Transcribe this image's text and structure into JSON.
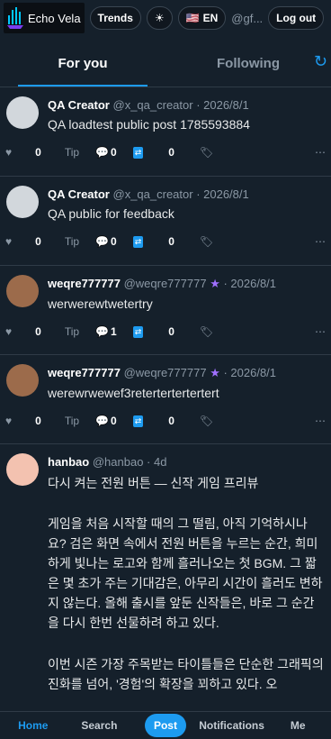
{
  "topbar": {
    "brand": "Echo Vela",
    "trends": "Trends",
    "lang": "EN",
    "handle": "@gf...",
    "logout": "Log out"
  },
  "tabs": {
    "for_you": "For you",
    "following": "Following"
  },
  "posts": [
    {
      "name": "QA Creator",
      "handle": "@x_qa_creator",
      "date": "2026/8/1",
      "text": "QA loadtest public post 1785593884",
      "likes": "0",
      "tip": "Tip",
      "comments": "0",
      "reposts": "0"
    },
    {
      "name": "QA Creator",
      "handle": "@x_qa_creator",
      "date": "2026/8/1",
      "text": "QA public for feedback",
      "likes": "0",
      "tip": "Tip",
      "comments": "0",
      "reposts": "0"
    },
    {
      "name": "weqre777777",
      "handle": "@weqre777777",
      "date": "2026/8/1",
      "text": "werwerewtwetertry",
      "likes": "0",
      "tip": "Tip",
      "comments": "1",
      "reposts": "0"
    },
    {
      "name": "weqre777777",
      "handle": "@weqre777777",
      "date": "2026/8/1",
      "text": "werewrwewef3retertertertertert",
      "likes": "0",
      "tip": "Tip",
      "comments": "0",
      "reposts": "0"
    },
    {
      "name": "hanbao",
      "handle": "@hanbao",
      "date": "4d",
      "title": "다시 켜는 전원 버튼 — 신작 게임 프리뷰",
      "p1": "게임을 처음 시작할 때의 그 떨림, 아직 기억하시나요? 검은 화면 속에서 전원 버튼을 누르는 순간, 희미하게 빛나는 로고와 함께 흘러나오는 첫 BGM. 그 짧은 몇 초가 주는 기대감은, 아무리 시간이 흘러도 변하지 않는다. 올해 출시를 앞둔 신작들은, 바로 그 순간을 다시 한번 선물하려 하고 있다.",
      "p2": "이번 시즌 가장 주목받는 타이틀들은 단순한 그래픽의 진화를 넘어, '경험'의 확장을 꾀하고 있다. 오"
    }
  ],
  "bottom_nav": {
    "home": "Home",
    "search": "Search",
    "post": "Post",
    "notifications": "Notifications",
    "me": "Me"
  }
}
